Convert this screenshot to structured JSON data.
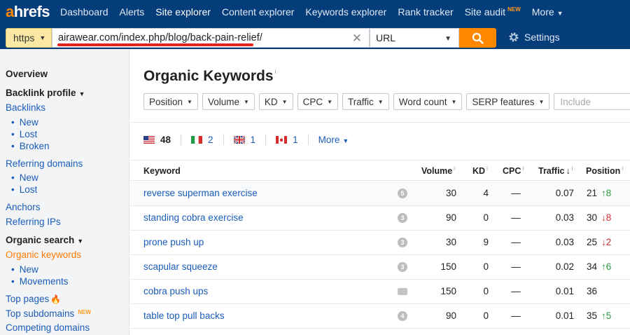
{
  "nav": {
    "logo_a": "a",
    "logo_rest": "hrefs",
    "items": [
      {
        "label": "Dashboard"
      },
      {
        "label": "Alerts"
      },
      {
        "label": "Site explorer"
      },
      {
        "label": "Content explorer"
      },
      {
        "label": "Keywords explorer"
      },
      {
        "label": "Rank tracker"
      },
      {
        "label": "Site audit"
      },
      {
        "label": "More"
      }
    ],
    "new_badge": "NEW"
  },
  "search": {
    "protocol": "https",
    "url": "airawear.com/index.php/blog/back-pain-relief/",
    "mode": "URL",
    "settings_label": "Settings"
  },
  "sidebar": {
    "overview": "Overview",
    "backlink_profile": "Backlink profile",
    "backlinks": "Backlinks",
    "bl_new": "New",
    "bl_lost": "Lost",
    "bl_broken": "Broken",
    "referring_domains": "Referring domains",
    "rd_new": "New",
    "rd_lost": "Lost",
    "anchors": "Anchors",
    "referring_ips": "Referring IPs",
    "organic_search": "Organic search",
    "organic_keywords": "Organic keywords",
    "ok_new": "New",
    "ok_movements": "Movements",
    "top_pages": "Top pages",
    "top_subdomains": "Top subdomains",
    "new_badge": "NEW",
    "competing_domains": "Competing domains"
  },
  "main": {
    "title": "Organic Keywords",
    "filters": [
      "Position",
      "Volume",
      "KD",
      "CPC",
      "Traffic",
      "Word count",
      "SERP features"
    ],
    "include_placeholder": "Include",
    "countries": [
      {
        "flag": "us",
        "count": "48"
      },
      {
        "flag": "it",
        "count": "2"
      },
      {
        "flag": "gb",
        "count": "1"
      },
      {
        "flag": "ca",
        "count": "1"
      }
    ],
    "more_label": "More",
    "columns": {
      "keyword": "Keyword",
      "volume": "Volume",
      "kd": "KD",
      "cpc": "CPC",
      "traffic": "Traffic",
      "position": "Position"
    },
    "rows": [
      {
        "keyword": "reverse superman exercise",
        "serp": "5",
        "volume": "30",
        "kd": "4",
        "cpc": "—",
        "traffic": "0.07",
        "position": "21",
        "change": "8",
        "dir": "up"
      },
      {
        "keyword": "standing cobra exercise",
        "serp": "3",
        "volume": "90",
        "kd": "0",
        "cpc": "—",
        "traffic": "0.03",
        "position": "30",
        "change": "8",
        "dir": "down"
      },
      {
        "keyword": "prone push up",
        "serp": "3",
        "volume": "30",
        "kd": "9",
        "cpc": "—",
        "traffic": "0.03",
        "position": "25",
        "change": "2",
        "dir": "down"
      },
      {
        "keyword": "scapular squeeze",
        "serp": "3",
        "volume": "150",
        "kd": "0",
        "cpc": "—",
        "traffic": "0.02",
        "position": "34",
        "change": "6",
        "dir": "up"
      },
      {
        "keyword": "cobra push ups",
        "serp": "video",
        "volume": "150",
        "kd": "0",
        "cpc": "—",
        "traffic": "0.01",
        "position": "36",
        "change": "",
        "dir": ""
      },
      {
        "keyword": "table top pull backs",
        "serp": "4",
        "volume": "90",
        "kd": "0",
        "cpc": "—",
        "traffic": "0.01",
        "position": "35",
        "change": "5",
        "dir": "up"
      }
    ]
  },
  "colors": {
    "nav_bg": "#053d7a",
    "accent": "#ff8800",
    "link": "#1a5cb8",
    "up": "#2d9a3d",
    "down": "#d12c2c"
  }
}
